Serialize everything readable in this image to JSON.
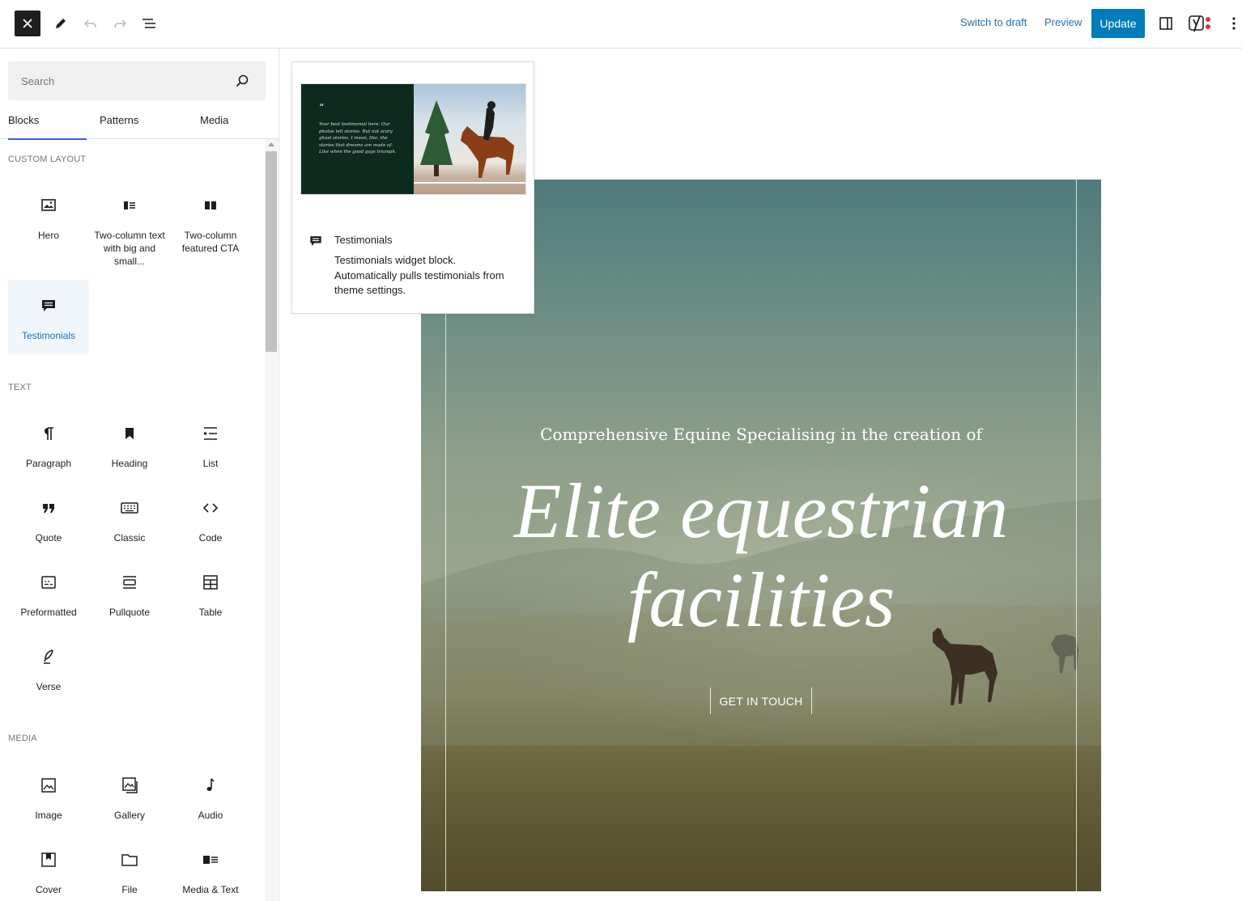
{
  "toolbar": {
    "switch_to_draft": "Switch to draft",
    "preview": "Preview",
    "update": "Update",
    "accent_color": "#007cba"
  },
  "inserter": {
    "search_placeholder": "Search",
    "tabs": [
      {
        "label": "Blocks",
        "active": true
      },
      {
        "label": "Patterns",
        "active": false
      },
      {
        "label": "Media",
        "active": false
      }
    ],
    "categories": {
      "custom_layout": {
        "title": "CUSTOM LAYOUT",
        "blocks": [
          {
            "label": "Hero",
            "icon": "hero-icon"
          },
          {
            "label": "Two-column text with big and small...",
            "icon": "two-column-text-icon"
          },
          {
            "label": "Two-column featured CTA",
            "icon": "two-column-cta-icon"
          },
          {
            "label": "Testimonials",
            "icon": "testimonials-icon",
            "selected": true
          }
        ]
      },
      "text": {
        "title": "TEXT",
        "blocks": [
          {
            "label": "Paragraph",
            "icon": "paragraph-icon"
          },
          {
            "label": "Heading",
            "icon": "heading-icon"
          },
          {
            "label": "List",
            "icon": "list-icon"
          },
          {
            "label": "Quote",
            "icon": "quote-icon"
          },
          {
            "label": "Classic",
            "icon": "classic-icon"
          },
          {
            "label": "Code",
            "icon": "code-icon"
          },
          {
            "label": "Preformatted",
            "icon": "preformatted-icon"
          },
          {
            "label": "Pullquote",
            "icon": "pullquote-icon"
          },
          {
            "label": "Table",
            "icon": "table-icon"
          },
          {
            "label": "Verse",
            "icon": "verse-icon"
          }
        ]
      },
      "media": {
        "title": "MEDIA",
        "blocks": [
          {
            "label": "Image",
            "icon": "image-icon"
          },
          {
            "label": "Gallery",
            "icon": "gallery-icon"
          },
          {
            "label": "Audio",
            "icon": "audio-icon"
          },
          {
            "label": "Cover",
            "icon": "cover-icon"
          },
          {
            "label": "File",
            "icon": "file-icon"
          },
          {
            "label": "Media & Text",
            "icon": "media-text-icon"
          }
        ]
      }
    }
  },
  "block_preview": {
    "title": "Testimonials",
    "description": "Testimonials widget block. Automatically pulls testimonials from theme settings.",
    "quote_mark": "“",
    "sample_text": "Your best testimonial here. Our photos tell stories. But not scary ghost stories. I mean, like, the stories that dreams are made of. Like when the good guys triumph."
  },
  "hero": {
    "subtitle": "Comprehensive Equine Specialising in the creation of",
    "title_line1": "Elite equestrian",
    "title_line2": "facilities",
    "button": "GET IN TOUCH"
  }
}
